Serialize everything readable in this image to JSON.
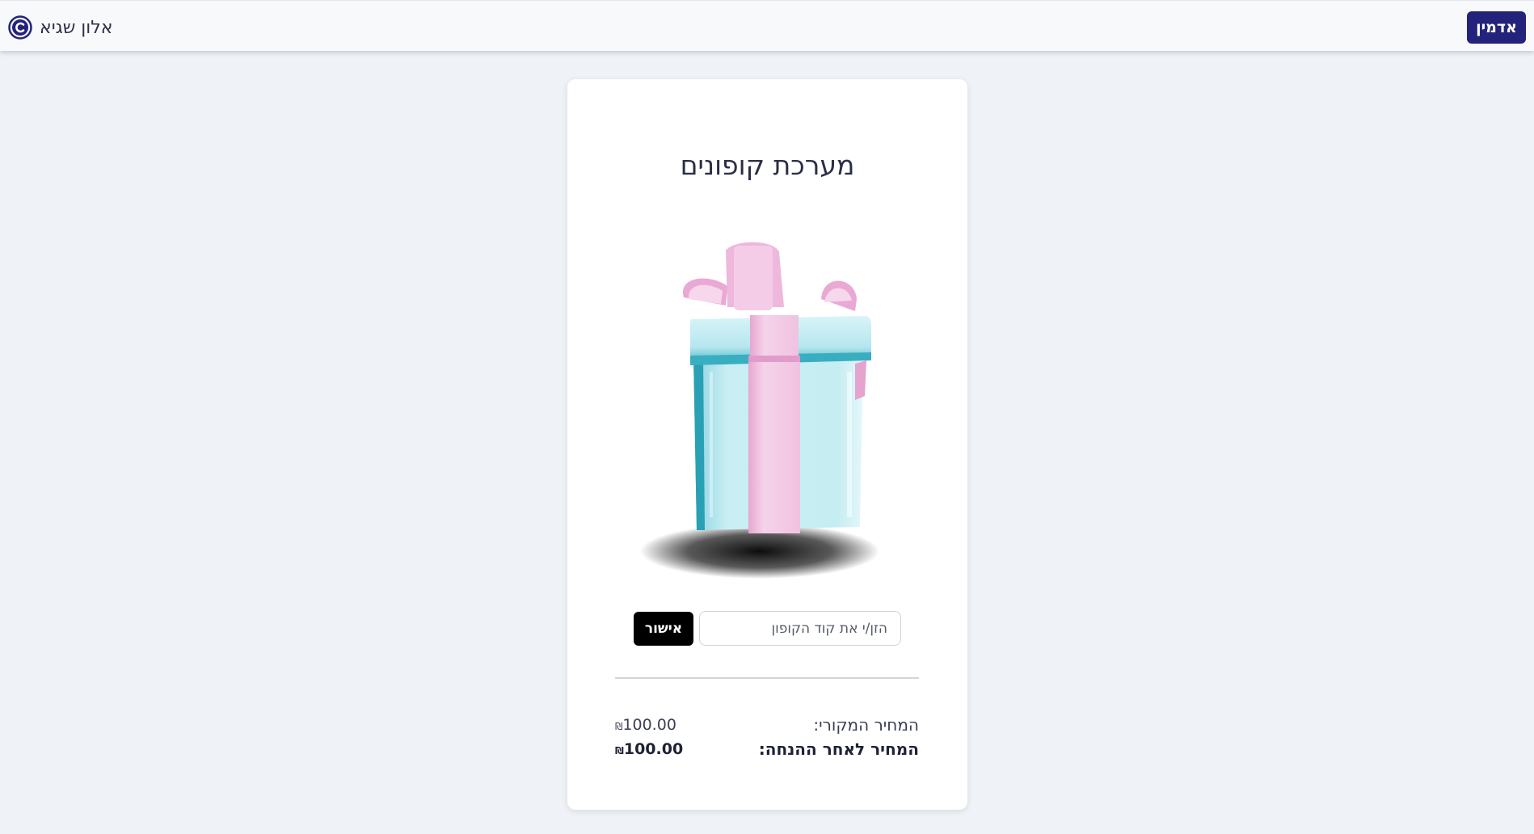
{
  "navbar": {
    "brand_name": "אלון שגיא",
    "logo_icon": "copyright-icon",
    "admin_label": "אדמין",
    "admin_color": "#23237b"
  },
  "card": {
    "title": "מערכת קופונים",
    "image_icon": "gift-box-icon",
    "coupon": {
      "placeholder": "הזן/י את קוד הקופון",
      "value": "",
      "submit_label": "אישור"
    },
    "prices": {
      "original_label": "המחיר המקורי:",
      "original_value": "100.00",
      "final_label": "המחיר לאחר ההנחה:",
      "final_value": "100.00",
      "currency_symbol": "₪"
    }
  },
  "colors": {
    "background": "#eff2f7",
    "gift_box": "#c6edf2",
    "ribbon": "#f3cbe6"
  }
}
